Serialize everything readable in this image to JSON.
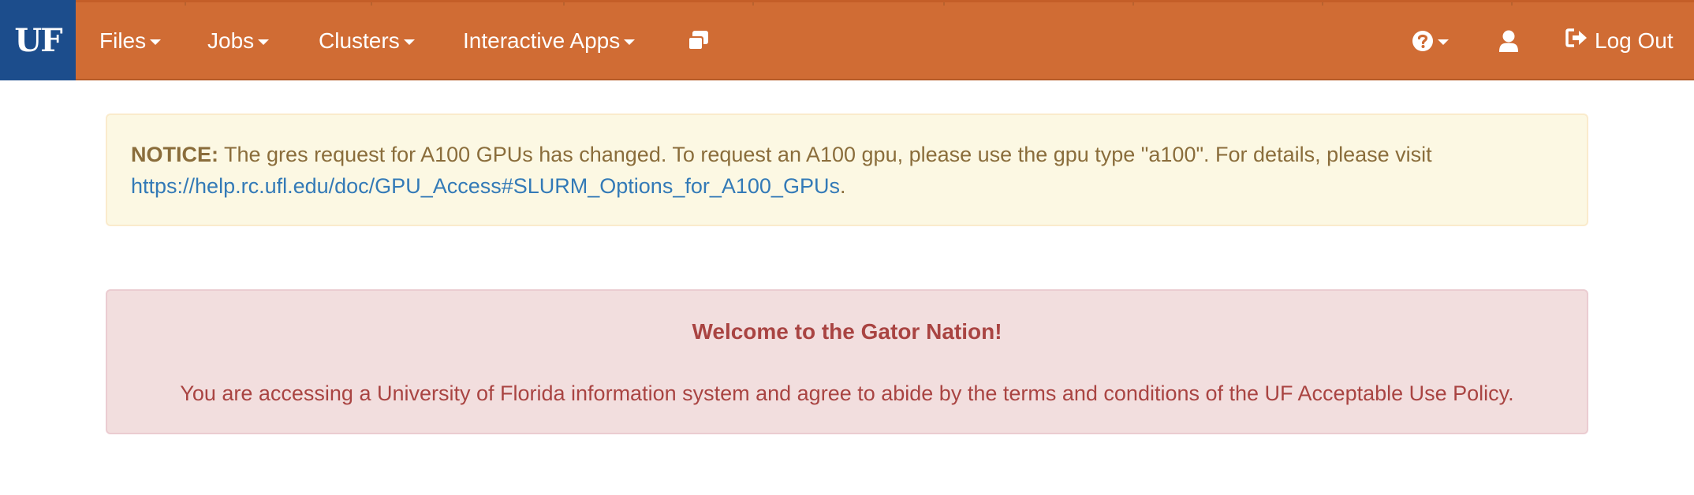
{
  "navbar": {
    "brand": "UF",
    "items": [
      {
        "label": "Files"
      },
      {
        "label": "Jobs"
      },
      {
        "label": "Clusters"
      },
      {
        "label": "Interactive Apps"
      }
    ],
    "sessions_icon": "windows-stack-icon",
    "help_icon": "question-circle-icon",
    "user_icon": "user-icon",
    "logout": {
      "label": "Log Out",
      "icon": "sign-out-icon"
    },
    "colors": {
      "bar": "#d06c34",
      "brand": "#1c4d8c"
    }
  },
  "notice": {
    "label": "NOTICE:",
    "text": " The gres request for A100 GPUs has changed. To request an A100 gpu, please use the gpu type \"a100\". For details, please visit",
    "link": "https://help.rc.ufl.edu/doc/GPU_Access#SLURM_Options_for_A100_GPUs",
    "suffix": "."
  },
  "welcome": {
    "title": "Welcome to the Gator Nation!",
    "text": "You are accessing a University of Florida information system and agree to abide by the terms and conditions of the UF Acceptable Use Policy."
  }
}
